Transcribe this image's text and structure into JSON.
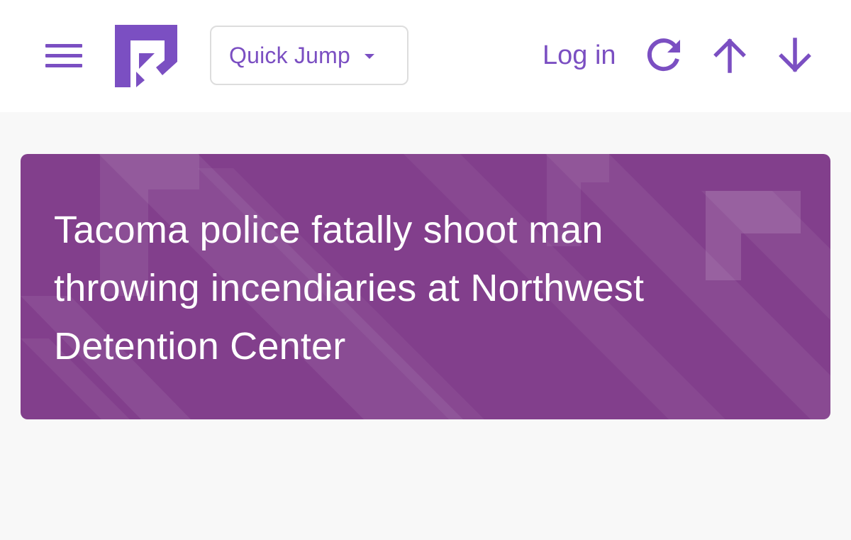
{
  "colors": {
    "accent": "#7b4fc2",
    "hero_bg": "#823f8c",
    "page_bg": "#f8f8f8",
    "header_bg": "#ffffff",
    "hero_text": "#ffffff"
  },
  "header": {
    "menu_icon": "hamburger-menu-icon",
    "logo_icon": "site-logo-icon",
    "quick_jump_label": "Quick Jump",
    "quick_jump_caret_icon": "caret-down-icon",
    "login_label": "Log in",
    "refresh_icon": "refresh-icon",
    "up_icon": "arrow-up-icon",
    "down_icon": "arrow-down-icon"
  },
  "article": {
    "title": "Tacoma police fatally shoot man throwing incendiaries at Northwest Detention Center"
  }
}
